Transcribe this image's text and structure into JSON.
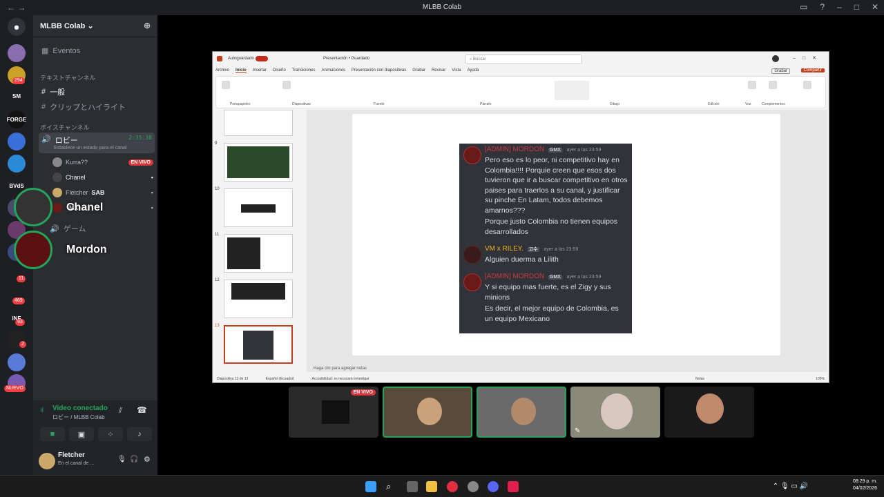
{
  "window": {
    "title": "MLBB Colab"
  },
  "server": {
    "name": "MLBB Colab"
  },
  "sidebar": {
    "events_label": "Eventos",
    "text_category": "テキストチャンネル",
    "text_channels": [
      "一般",
      "クリップとハイライト"
    ],
    "voice_category": "ボイスチャンネル",
    "voice_channel": {
      "name": "ロビー",
      "timer": "2:35:38",
      "status_placeholder": "Establece un estado para el canal"
    },
    "voice_users": [
      {
        "name": "Kurra??",
        "badge": "EN VIVO"
      },
      {
        "name": "Chanel",
        "badge": ""
      },
      {
        "name": "Fletcher",
        "badge": "SAB"
      },
      {
        "name": "",
        "badge": "MX"
      }
    ],
    "game_channel": "ゲーム"
  },
  "guild_badges": {
    "b1": "294",
    "sm": "SM",
    "bvds": "BVdS",
    "n11": "11",
    "n469": "469",
    "n93": "93",
    "n2": "2",
    "nuevo": "NUEVO"
  },
  "overlay": {
    "chanel": "Chanel",
    "mordon": "Mordon"
  },
  "rtc": {
    "status": "Video conectado",
    "channel": "ロビー / MLBB Colab"
  },
  "user": {
    "name": "Fletcher",
    "status": "En el canal de ..."
  },
  "ppt": {
    "autosave": "Autoguardado",
    "doc_title": "Presentación • Guardado",
    "search_placeholder": "Buscar",
    "menu": [
      "Archivo",
      "Inicio",
      "Insertar",
      "Diseño",
      "Transiciones",
      "Animaciones",
      "Presentación con diapositivas",
      "Grabar",
      "Revisar",
      "Vista",
      "Ayuda"
    ],
    "record": "Grabar",
    "share": "Compartir",
    "groups": [
      "Portapapeles",
      "Diapositivas",
      "Fuente",
      "Párrafo",
      "Dibujo",
      "Edición",
      "Voz",
      "Complementos"
    ],
    "thumb_numbers": [
      "9",
      "10",
      "11",
      "12",
      "13"
    ],
    "notes_placeholder": "Haga clic para agregar notas",
    "status_slide": "Diapositiva 13 de 13",
    "status_lang": "Español (Ecuador)",
    "status_access": "Accesibilidad: es necesario investigar",
    "status_notes": "Notas",
    "status_zoom": "105%"
  },
  "chat": {
    "messages": [
      {
        "name": "[ADMIN] MORDON",
        "tag": "GMX",
        "time": "ayer a las 23:59",
        "color": "#c73a4a",
        "lines": [
          "Pero eso es lo peor, ni competitivo hay en Colombia!!!! Porquie creen que esos dos tuvieron que ir a buscar competitivo en otros paises para traerlos a su canal, y justificar su pinche En Latam, todos debemos amarnos???",
          "Porque justo Colombia no tienen equipos desarrollados"
        ]
      },
      {
        "name": "VM x RILEY.",
        "tag": "고수",
        "time": "ayer a las 23:59",
        "color": "#e6b422",
        "lines": [
          "Alguien duerma a Lilith"
        ]
      },
      {
        "name": "[ADMIN] MORDON",
        "tag": "GMX",
        "time": "ayer a las 23:59",
        "color": "#c73a4a",
        "lines": [
          "Y si equipo mas fuerte, es el Zigy y sus minions",
          "Es decir, el mejor equipo de Colombia, es un equipo Mexicano"
        ]
      }
    ]
  },
  "tiles": {
    "live_badge": "EN VIVO"
  },
  "taskbar": {
    "time": "08:29 p. m.",
    "date": "04/02/2026"
  }
}
